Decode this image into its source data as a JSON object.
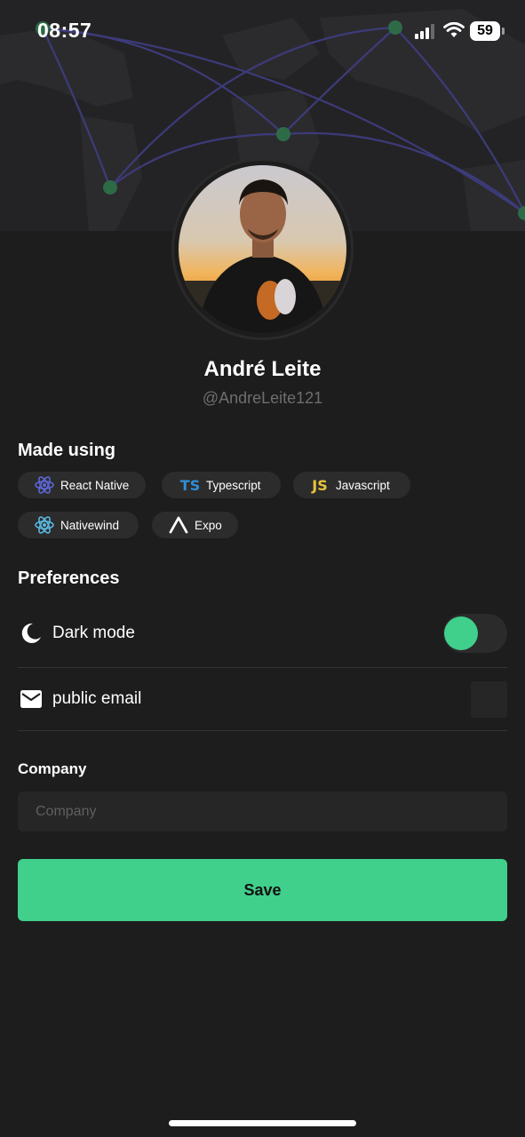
{
  "status_bar": {
    "time": "08:57",
    "battery": "59"
  },
  "profile": {
    "name": "André Leite",
    "handle": "@AndreLeite121"
  },
  "made_using": {
    "title": "Made using",
    "chips": [
      {
        "label": "React Native",
        "icon": "react-icon"
      },
      {
        "label": "Typescript",
        "icon": "typescript-icon"
      },
      {
        "label": "Javascript",
        "icon": "javascript-icon"
      },
      {
        "label": "Nativewind",
        "icon": "react-icon"
      },
      {
        "label": "Expo",
        "icon": "expo-icon"
      }
    ],
    "icon_text": {
      "typescript": "TS",
      "javascript": "JS"
    }
  },
  "preferences": {
    "title": "Preferences",
    "dark_mode": {
      "label": "Dark mode",
      "icon": "moon-icon",
      "enabled": true
    },
    "public_email": {
      "label": "public email",
      "icon": "mail-icon",
      "checked": false
    }
  },
  "company": {
    "title": "Company",
    "placeholder": "Company",
    "value": ""
  },
  "save_label": "Save",
  "colors": {
    "accent": "#41cf8c",
    "background": "#1d1d1d",
    "surface": "#2c2c2c",
    "react": "#5e66d8",
    "nativewind": "#5ab8e0",
    "typescript": "#2f8fd6",
    "javascript": "#e6c43a"
  }
}
